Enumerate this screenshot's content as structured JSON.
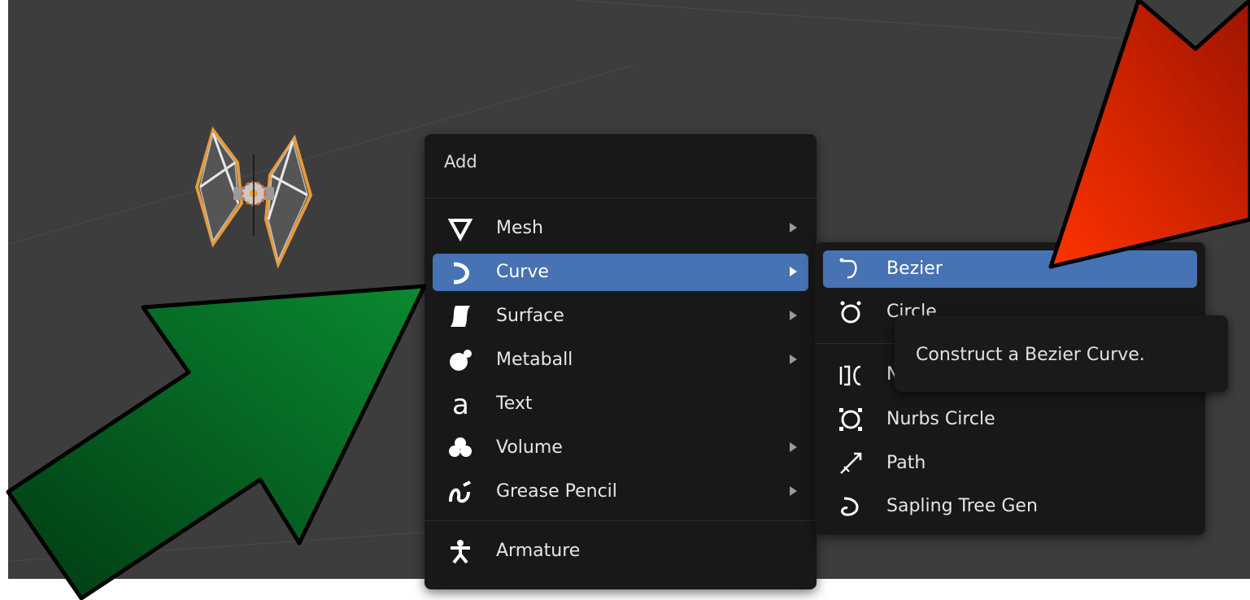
{
  "add_menu": {
    "title": "Add",
    "items": [
      {
        "label": "Mesh",
        "icon": "mesh-icon"
      },
      {
        "label": "Curve",
        "icon": "curve-icon",
        "selected": true
      },
      {
        "label": "Surface",
        "icon": "surface-icon"
      },
      {
        "label": "Metaball",
        "icon": "metaball-icon"
      },
      {
        "label": "Text",
        "icon": "text-icon"
      },
      {
        "label": "Volume",
        "icon": "volume-icon"
      },
      {
        "label": "Grease Pencil",
        "icon": "grease-pencil-icon"
      },
      {
        "label": "Armature",
        "icon": "armature-icon"
      }
    ]
  },
  "curve_menu": {
    "items": [
      {
        "label": "Bezier",
        "icon": "bezier-icon",
        "selected": true
      },
      {
        "label": "Circle",
        "icon": "circle-curve-icon"
      },
      {
        "label": "N",
        "icon": "nurbs-curve-icon"
      },
      {
        "label": "Nurbs Circle",
        "icon": "nurbs-circle-icon"
      },
      {
        "label": "Path",
        "icon": "path-icon"
      },
      {
        "label": "Sapling Tree Gen",
        "icon": "sapling-icon"
      }
    ]
  },
  "tooltip": {
    "text": "Construct a Bezier Curve."
  },
  "colors": {
    "selection": "#4772b3",
    "menu_bg": "#181818",
    "viewport_bg": "#3d3d3d",
    "object_outline": "#e59a3c",
    "green_arrow": "#0a7a2e",
    "red_arrow": "#e02800"
  }
}
